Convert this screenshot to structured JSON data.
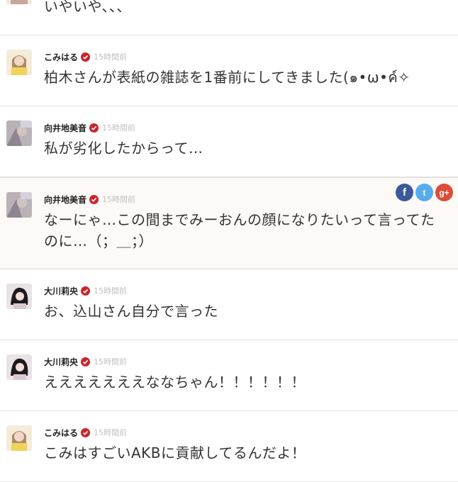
{
  "posts": [
    {
      "user": "",
      "time": "",
      "text": "いやいや、、、"
    },
    {
      "user": "こみはる",
      "time": "15時間前",
      "text": "柏木さんが表紙の雑誌を1番前にしてきました(๑•ω•ค์✧"
    },
    {
      "user": "向井地美音",
      "time": "15時間前",
      "text": "私が劣化したからって…"
    },
    {
      "user": "向井地美音",
      "time": "15時間前",
      "text": "なーにゃ…この間までみーおんの顔になりたいって言ってたのに…（；＿；）"
    },
    {
      "user": "大川莉央",
      "time": "15時間前",
      "text": "お、込山さん自分で言った"
    },
    {
      "user": "大川莉央",
      "time": "15時間前",
      "text": "えええええええななちゃん！！！！！！"
    },
    {
      "user": "こみはる",
      "time": "15時間前",
      "text": "こみはすごいAKBに貢献してるんだよ！"
    }
  ],
  "share": {
    "facebook": "f",
    "twitter": "t",
    "googleplus": "g+"
  },
  "colors": {
    "verified": "#c9252c",
    "facebook": "#3b5998",
    "twitter": "#55acee",
    "googleplus": "#dd4b39"
  }
}
